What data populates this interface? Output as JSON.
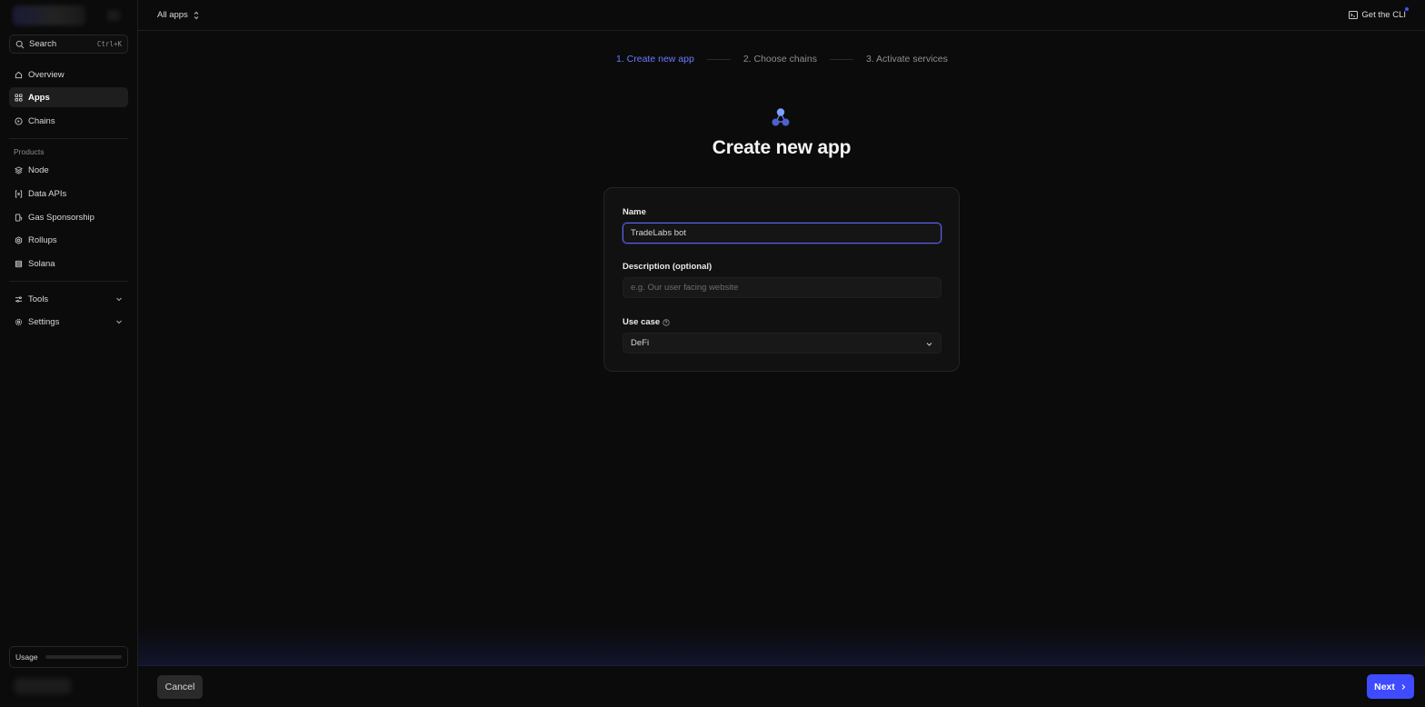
{
  "sidebar": {
    "search": {
      "label": "Search",
      "shortcut": "Ctrl+K",
      "icon": "search-icon"
    },
    "primary": [
      {
        "label": "Overview",
        "icon": "home-icon"
      },
      {
        "label": "Apps",
        "icon": "grid-icon",
        "active": true
      },
      {
        "label": "Chains",
        "icon": "chains-icon"
      }
    ],
    "products_label": "Products",
    "products": [
      {
        "label": "Node",
        "icon": "node-icon"
      },
      {
        "label": "Data APIs",
        "icon": "data-apis-icon"
      },
      {
        "label": "Gas Sponsorship",
        "icon": "gas-icon"
      },
      {
        "label": "Rollups",
        "icon": "rollups-icon"
      },
      {
        "label": "Solana",
        "icon": "solana-icon"
      }
    ],
    "expandables": [
      {
        "label": "Tools",
        "icon": "tools-icon"
      },
      {
        "label": "Settings",
        "icon": "gear-icon"
      }
    ],
    "usage": {
      "label": "Usage",
      "fraction": 0
    }
  },
  "topbar": {
    "app_switcher": "All apps",
    "cli_link": "Get the CLI",
    "accent": "#3d57ff"
  },
  "steps": [
    {
      "label": "1. Create new app",
      "active": true
    },
    {
      "label": "2. Choose chains",
      "active": false
    },
    {
      "label": "3. Activate services",
      "active": false
    }
  ],
  "hero": {
    "title": "Create new app",
    "icon": "app-cluster-icon"
  },
  "form": {
    "name": {
      "label": "Name",
      "value": "TradeLabs bot"
    },
    "description": {
      "label": "Description (optional)",
      "placeholder": "e.g. Our user facing website",
      "value": ""
    },
    "use_case": {
      "label": "Use case",
      "value": "DeFi",
      "help_icon": "help-circle-icon"
    }
  },
  "footer": {
    "cancel": "Cancel",
    "next": "Next"
  },
  "colors": {
    "primary": "#3e4bff",
    "step_active": "#6b7bff",
    "focus_ring": "#5a64e8"
  }
}
